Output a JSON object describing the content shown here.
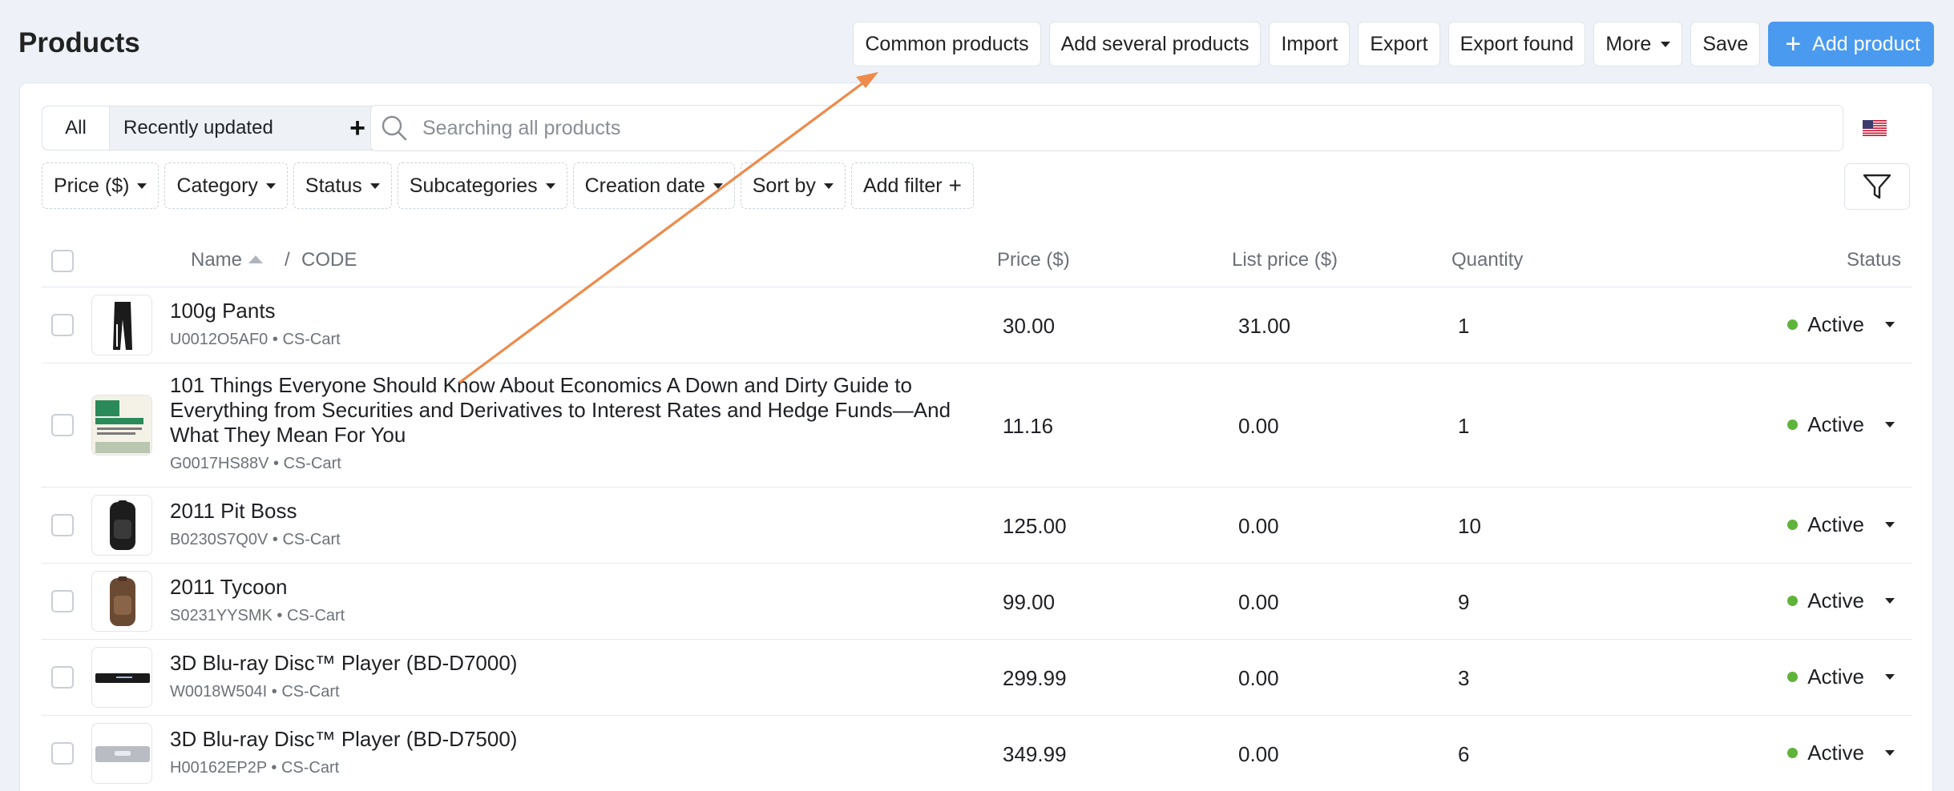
{
  "page": {
    "title": "Products"
  },
  "toolbar": {
    "common_products": "Common products",
    "add_several": "Add several products",
    "import": "Import",
    "export": "Export",
    "export_found": "Export found",
    "more": "More",
    "save": "Save",
    "add_product": "Add product",
    "accent_color": "#4a9af0"
  },
  "tabs": {
    "all": "All",
    "recently_updated": "Recently updated",
    "add_icon": "plus-icon"
  },
  "search": {
    "placeholder": "Searching all products",
    "value": ""
  },
  "language_flag": "us-flag-icon",
  "filters": {
    "price": "Price ($)",
    "category": "Category",
    "status": "Status",
    "subcategories": "Subcategories",
    "creation_date": "Creation date",
    "sort_by": "Sort by",
    "add_filter": "Add filter"
  },
  "table": {
    "headers": {
      "name": "Name",
      "slash": "/",
      "code": "CODE",
      "price": "Price ($)",
      "list_price": "List price ($)",
      "quantity": "Quantity",
      "status": "Status"
    },
    "rows": [
      {
        "name": "100g Pants",
        "code": "U0012O5AF0",
        "vendor": "CS-Cart",
        "price": "30.00",
        "list_price": "31.00",
        "quantity": "1",
        "status": "Active"
      },
      {
        "name": "101 Things Everyone Should Know About Economics A Down and Dirty Guide to Everything from Securities and Derivatives to Interest Rates and Hedge Funds—And What They Mean For You",
        "code": "G0017HS88V",
        "vendor": "CS-Cart",
        "price": "11.16",
        "list_price": "0.00",
        "quantity": "1",
        "status": "Active"
      },
      {
        "name": "2011 Pit Boss",
        "code": "B0230S7Q0V",
        "vendor": "CS-Cart",
        "price": "125.00",
        "list_price": "0.00",
        "quantity": "10",
        "status": "Active"
      },
      {
        "name": "2011 Tycoon",
        "code": "S0231YYSMK",
        "vendor": "CS-Cart",
        "price": "99.00",
        "list_price": "0.00",
        "quantity": "9",
        "status": "Active"
      },
      {
        "name": "3D Blu-ray Disc™ Player (BD-D7000)",
        "code": "W0018W504I",
        "vendor": "CS-Cart",
        "price": "299.99",
        "list_price": "0.00",
        "quantity": "3",
        "status": "Active"
      },
      {
        "name": "3D Blu-ray Disc™ Player (BD-D7500)",
        "code": "H00162EP2P",
        "vendor": "CS-Cart",
        "price": "349.99",
        "list_price": "0.00",
        "quantity": "6",
        "status": "Active"
      }
    ],
    "meta_separator": "•"
  },
  "annotation_arrow_color": "#ee8a4a",
  "status_color": "#5fb33a"
}
